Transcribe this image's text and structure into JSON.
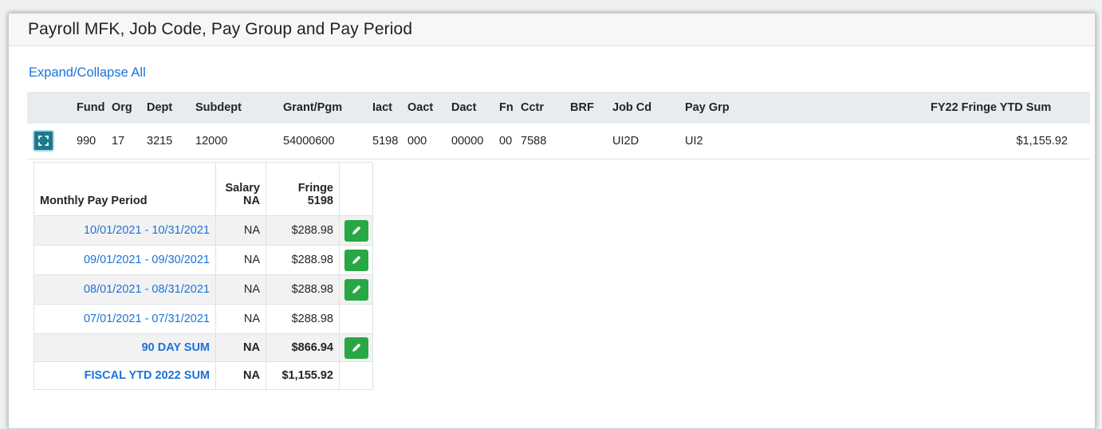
{
  "panel": {
    "title": "Payroll MFK, Job Code, Pay Group and Pay Period",
    "expand_link": "Expand/Collapse All"
  },
  "mfk_table": {
    "columns": [
      "Fund",
      "Org",
      "Dept",
      "Subdept",
      "Grant/Pgm",
      "Iact",
      "Oact",
      "Dact",
      "Fn",
      "Cctr",
      "BRF",
      "Job Cd",
      "Pay Grp",
      "FY22 Fringe YTD Sum"
    ],
    "row": {
      "fund": "990",
      "org": "17",
      "dept": "3215",
      "subdept": "12000",
      "grant_pgm": "54000600",
      "iact": "5198",
      "oact": "000",
      "dact": "00000",
      "fn": "00",
      "cctr": "7588",
      "brf": "",
      "job_cd": "UI2D",
      "pay_grp": "UI2",
      "fy22_fringe_ytd_sum": "$1,155.92"
    }
  },
  "pay_table": {
    "headers": {
      "period": "Monthly Pay Period",
      "salary_line1": "Salary",
      "salary_line2": "NA",
      "fringe_line1": "Fringe",
      "fringe_line2": "5198"
    },
    "periods": [
      {
        "period": "10/01/2021 - 10/31/2021",
        "salary": "NA",
        "fringe": "$288.98",
        "editable": true
      },
      {
        "period": "09/01/2021 - 09/30/2021",
        "salary": "NA",
        "fringe": "$288.98",
        "editable": true
      },
      {
        "period": "08/01/2021 - 08/31/2021",
        "salary": "NA",
        "fringe": "$288.98",
        "editable": true
      },
      {
        "period": "07/01/2021 - 07/31/2021",
        "salary": "NA",
        "fringe": "$288.98",
        "editable": false
      }
    ],
    "sum_90": {
      "label": "90 DAY SUM",
      "salary": "NA",
      "fringe": "$866.94"
    },
    "sum_ytd": {
      "label": "FISCAL YTD 2022 SUM",
      "salary": "NA",
      "fringe": "$1,155.92"
    }
  },
  "colors": {
    "link": "#1a73d9",
    "edit_button": "#28a745",
    "expand_button": "#1c7a8c"
  },
  "icons": {
    "expand": "expand-icon",
    "edit": "pencil-icon"
  }
}
